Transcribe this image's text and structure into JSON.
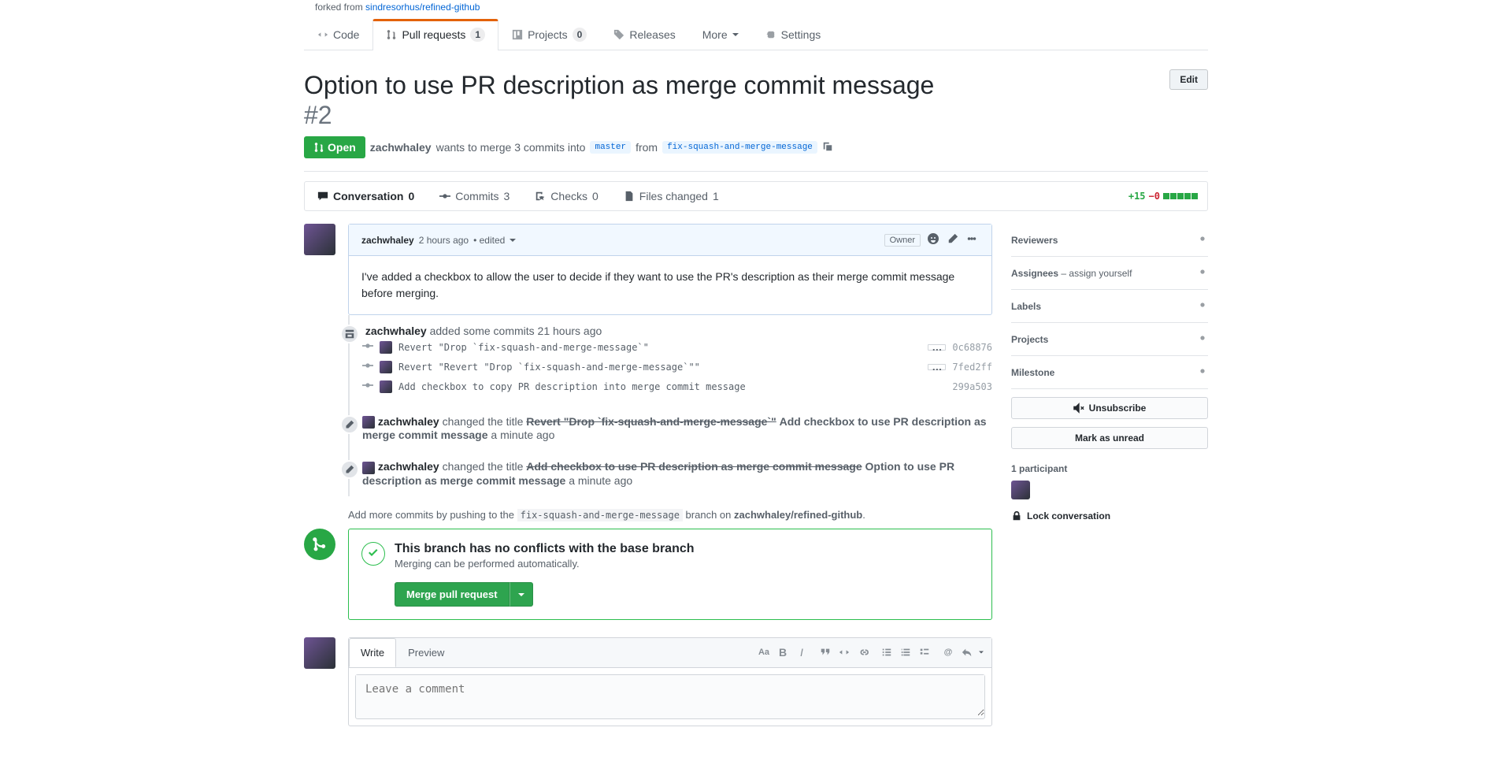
{
  "forked": {
    "prefix": "forked from",
    "repo": "sindresorhus/refined-github"
  },
  "nav": {
    "code": "Code",
    "pr": "Pull requests",
    "pr_count": "1",
    "projects": "Projects",
    "projects_count": "0",
    "releases": "Releases",
    "more": "More",
    "settings": "Settings"
  },
  "header": {
    "title": "Option to use PR description as merge commit message",
    "number": "#2",
    "edit": "Edit",
    "state": "Open",
    "author": "zachwhaley",
    "wants": "wants to merge 3 commits into",
    "base": "master",
    "from": "from",
    "head": "fix-squash-and-merge-message"
  },
  "tabs": {
    "conversation": "Conversation",
    "conversation_count": "0",
    "commits": "Commits",
    "commits_count": "3",
    "checks": "Checks",
    "checks_count": "0",
    "files": "Files changed",
    "files_count": "1",
    "diff_add": "+15",
    "diff_del": "−0"
  },
  "comment1": {
    "author": "zachwhaley",
    "time": "2 hours ago",
    "edited": "• edited",
    "owner": "Owner",
    "body": "I've added a checkbox to allow the user to decide if they want to use the PR's description as their merge commit message before merging."
  },
  "commits_event": {
    "author": "zachwhaley",
    "text": "added some commits 21 hours ago",
    "rows": [
      {
        "msg": "Revert \"Drop `fix-squash-and-merge-message`\"",
        "sha": "0c68876",
        "ellipsis": true
      },
      {
        "msg": "Revert \"Revert \"Drop `fix-squash-and-merge-message`\"\"",
        "sha": "7fed2ff",
        "ellipsis": true
      },
      {
        "msg": "Add checkbox to copy PR description into merge commit message",
        "sha": "299a503",
        "ellipsis": false
      }
    ]
  },
  "rename1": {
    "author": "zachwhaley",
    "verb": "changed the title",
    "old": "Revert \"Drop `fix-squash-and-merge-message`\"",
    "new": "Add checkbox to use PR description as merge commit message",
    "time": "a minute ago"
  },
  "rename2": {
    "author": "zachwhaley",
    "verb": "changed the title",
    "old": "Add checkbox to use PR description as merge commit message",
    "new": "Option to use PR description as merge commit message",
    "time": "a minute ago"
  },
  "push_hint": {
    "prefix": "Add more commits by pushing to the",
    "branch": "fix-squash-and-merge-message",
    "mid": "branch on",
    "repo": "zachwhaley/refined-github"
  },
  "merge": {
    "heading": "This branch has no conflicts with the base branch",
    "sub": "Merging can be performed automatically.",
    "button": "Merge pull request"
  },
  "commentform": {
    "write": "Write",
    "preview": "Preview",
    "placeholder": "Leave a comment"
  },
  "sidebar": {
    "reviewers": "Reviewers",
    "assignees": "Assignees",
    "assign_self_prefix": "– ",
    "assign_self": "assign yourself",
    "labels": "Labels",
    "projects": "Projects",
    "milestone": "Milestone",
    "unsubscribe": "Unsubscribe",
    "mark_unread": "Mark as unread",
    "participants": "1 participant",
    "lock": "Lock conversation"
  }
}
